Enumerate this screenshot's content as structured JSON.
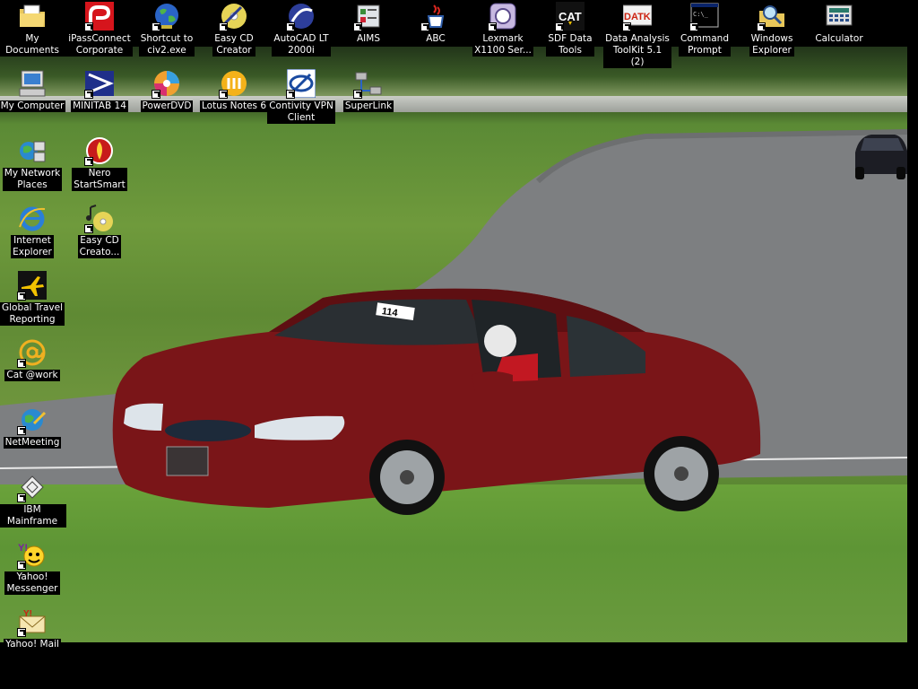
{
  "desktop": {
    "icons": [
      {
        "label": "My Documents",
        "icon": "folder-documents-icon"
      },
      {
        "label": "iPassConnect\nCorporate",
        "icon": "ipass-icon"
      },
      {
        "label": "Shortcut to\nciv2.exe",
        "icon": "globe-icon"
      },
      {
        "label": "Easy CD\nCreator",
        "icon": "cd-creator-icon"
      },
      {
        "label": "AutoCAD LT\n2000i",
        "icon": "autocad-icon"
      },
      {
        "label": "AIMS",
        "icon": "aims-icon"
      },
      {
        "label": "ABC",
        "icon": "java-cup-icon"
      },
      {
        "label": "Lexmark\nX1100 Ser...",
        "icon": "lexmark-icon"
      },
      {
        "label": "SDF Data\nTools",
        "icon": "cat-logo-icon"
      },
      {
        "label": "Data Analysis\nToolKit 5.1 (2)",
        "icon": "datk-icon"
      },
      {
        "label": "Command\nPrompt",
        "icon": "command-prompt-icon"
      },
      {
        "label": "Windows\nExplorer",
        "icon": "explorer-icon"
      },
      {
        "label": "Calculator",
        "icon": "calculator-icon"
      },
      {
        "label": "My Computer",
        "icon": "computer-icon"
      },
      {
        "label": "MINITAB 14",
        "icon": "minitab-icon"
      },
      {
        "label": "PowerDVD",
        "icon": "dvd-icon"
      },
      {
        "label": "Lotus Notes 6",
        "icon": "lotus-notes-icon"
      },
      {
        "label": "Contivity VPN\nClient",
        "icon": "vpn-icon"
      },
      {
        "label": "SuperLink",
        "icon": "superlink-icon"
      },
      {
        "label": "My Network\nPlaces",
        "icon": "network-icon"
      },
      {
        "label": "Nero\nStartSmart",
        "icon": "nero-icon"
      },
      {
        "label": "Internet\nExplorer",
        "icon": "internet-explorer-icon"
      },
      {
        "label": "Easy CD\nCreato...",
        "icon": "cd-music-icon"
      },
      {
        "label": "Global Travel\nReporting",
        "icon": "airplane-icon"
      },
      {
        "label": "Cat @work",
        "icon": "at-sign-icon"
      },
      {
        "label": "NetMeeting",
        "icon": "netmeeting-icon"
      },
      {
        "label": "IBM Mainframe",
        "icon": "mainframe-icon"
      },
      {
        "label": "Yahoo!\nMessenger",
        "icon": "yahoo-messenger-icon"
      },
      {
        "label": "Yahoo! Mail",
        "icon": "yahoo-mail-icon"
      }
    ]
  },
  "wallpaper": {
    "car_number": "114",
    "colors": {
      "car": "#7a1518",
      "grass": "#6a9a3a",
      "track": "#7c7e80",
      "desktop_bg": "#000000"
    }
  }
}
